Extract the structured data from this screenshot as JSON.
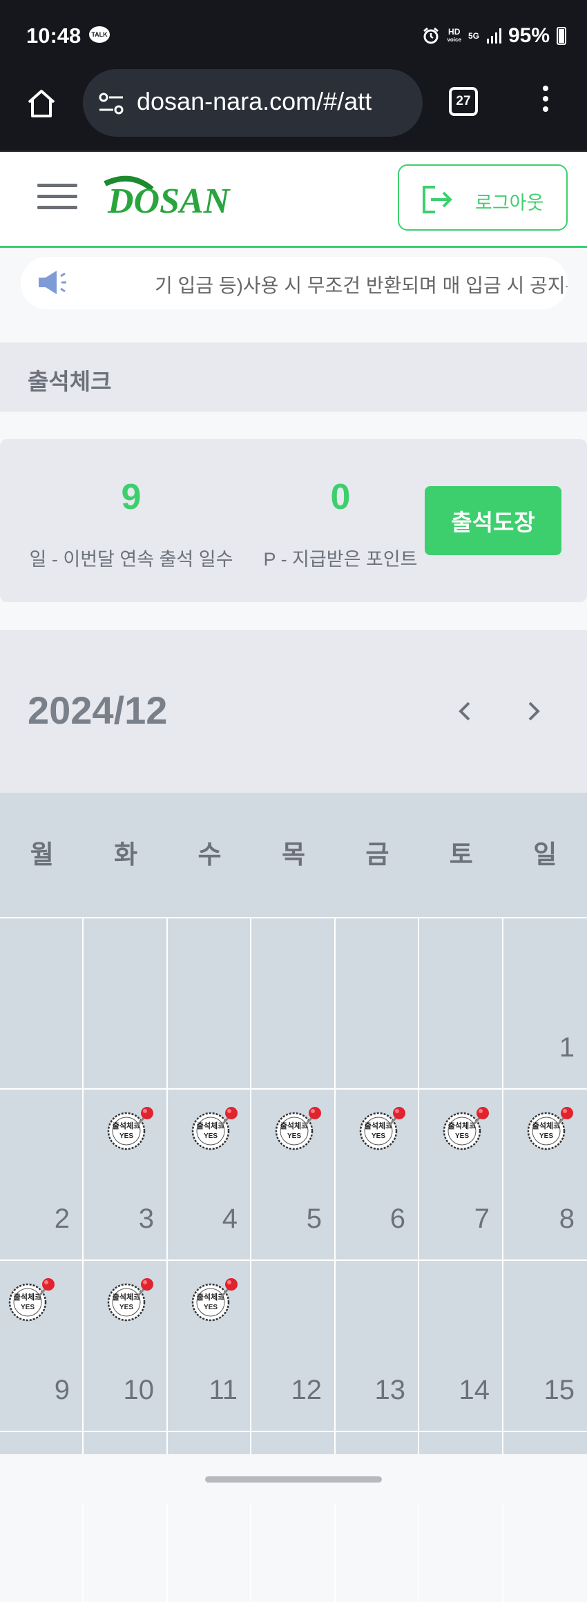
{
  "status_bar": {
    "time": "10:48",
    "talk_badge": "TALK",
    "hd": "HD",
    "voice": "voice",
    "net": "5G",
    "battery": "95%"
  },
  "browser": {
    "url": "dosan-nara.com/#/att",
    "tab_count": "27"
  },
  "header": {
    "logo_text": "DOSAN",
    "logout_label": "로그아웃"
  },
  "notice": {
    "text": "기 입금 등)사용 시 무조건 반환되며 매 입금 시 공지된"
  },
  "page": {
    "title": "출석체크"
  },
  "stats": {
    "consecutive_days": "9",
    "consecutive_label": "일 - 이번달 연속 출석 일수",
    "points": "0",
    "points_label": "P - 지급받은 포인트",
    "attend_button": "출석도장"
  },
  "calendar": {
    "year_month": "2024/12",
    "weekdays": [
      "월",
      "화",
      "수",
      "목",
      "금",
      "토",
      "일"
    ],
    "stamp_text": "출석체크",
    "stamp_sub": "YES",
    "days": [
      "1",
      "2",
      "3",
      "4",
      "5",
      "6",
      "7",
      "8",
      "9",
      "10",
      "11",
      "12",
      "13",
      "14",
      "15"
    ],
    "stamped_days": [
      3,
      4,
      5,
      6,
      7,
      8,
      9,
      10,
      11
    ]
  },
  "colors": {
    "accent": "#3dcf6e",
    "panel": "#e7e9ef",
    "calendar_bg": "#d2dae1",
    "text_muted": "#6c717a"
  }
}
